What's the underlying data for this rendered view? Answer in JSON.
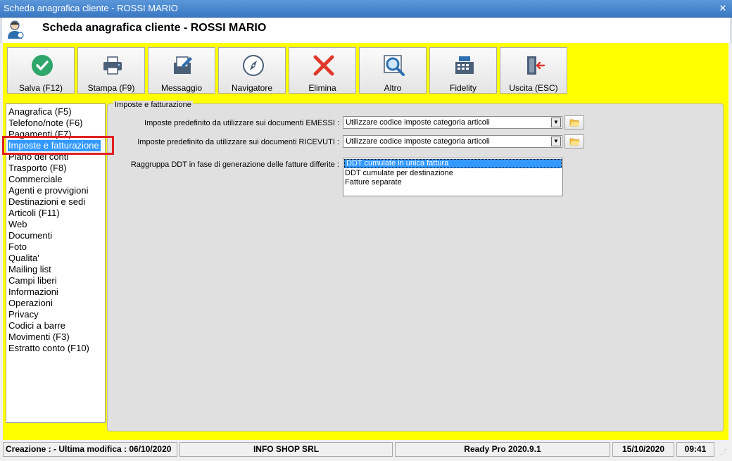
{
  "window": {
    "title": "Scheda anagrafica cliente - ROSSI MARIO",
    "close_glyph": "✕"
  },
  "header": {
    "title": "Scheda anagrafica cliente - ROSSI MARIO",
    "icon": "customer-icon"
  },
  "toolbar": {
    "buttons": [
      {
        "label": "Salva (F12)",
        "icon": "check-circle-icon"
      },
      {
        "label": "Stampa (F9)",
        "icon": "printer-icon"
      },
      {
        "label": "Messaggio",
        "icon": "message-icon"
      },
      {
        "label": "Navigatore",
        "icon": "compass-icon"
      },
      {
        "label": "Elimina",
        "icon": "delete-x-icon"
      },
      {
        "label": "Altro",
        "icon": "magnifier-icon"
      },
      {
        "label": "Fidelity",
        "icon": "cash-register-icon"
      },
      {
        "label": "Uscita (ESC)",
        "icon": "exit-door-icon"
      }
    ]
  },
  "nav": {
    "items": [
      "Anagrafica (F5)",
      "Telefono/note (F6)",
      "Pagamenti (F7)",
      "Imposte e fatturazione",
      "Piano dei conti",
      "Trasporto (F8)",
      "Commerciale",
      "Agenti e provvigioni",
      "Destinazioni e sedi",
      "Articoli (F11)",
      "Web",
      "Documenti",
      "Foto",
      "Qualita'",
      "Mailing list",
      "Campi liberi",
      "Informazioni",
      "Operazioni",
      "Privacy",
      "Codici a barre",
      "Movimenti (F3)",
      "Estratto conto (F10)"
    ],
    "selected": "Imposte e fatturazione"
  },
  "panel": {
    "legend": "Imposte e fatturazione",
    "emessi_label": "Imposte predefinito da utilizzare sui documenti EMESSI :",
    "emessi_value": "Utilizzare codice imposte categoria articoli",
    "ricevuti_label": "Imposte predefinito da utilizzare sui documenti RICEVUTI :",
    "ricevuti_value": "Utilizzare codice imposte categoria articoli",
    "raggruppa_label": "Raggruppa DDT in fase di generazione delle fatture differite :",
    "raggruppa_options": [
      "DDT cumulate in unica fattura",
      "DDT cumulate per destinazione",
      "Fatture separate"
    ],
    "raggruppa_selected": "DDT cumulate in unica fattura"
  },
  "status": {
    "creazione": "Creazione :  - Ultima modifica : 06/10/2020",
    "company": "INFO SHOP SRL",
    "version": "Ready Pro 2020.9.1",
    "date": "15/10/2020",
    "time": "09:41"
  },
  "colors": {
    "workspace": "#ffff00",
    "selection": "#3399ff",
    "highlight": "#e02020"
  }
}
